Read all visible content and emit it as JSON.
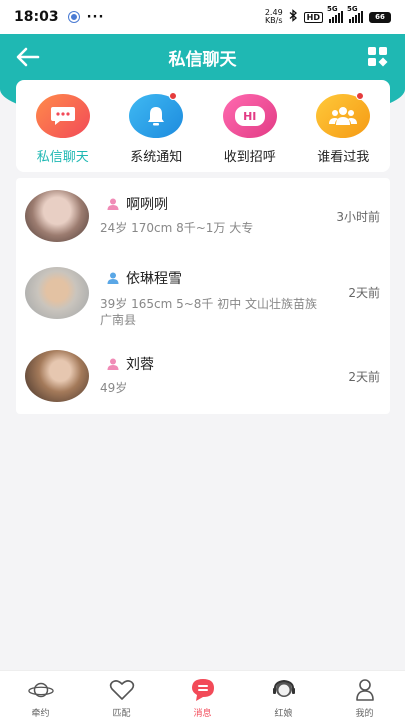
{
  "status_bar": {
    "time": "18:03",
    "net_speed_value": "2.49",
    "net_speed_unit": "KB/s",
    "hd": "HD",
    "sim1": "5G",
    "sim2": "5G",
    "battery": "66",
    "dots": "···"
  },
  "header": {
    "title": "私信聊天"
  },
  "categories": [
    {
      "label": "私信聊天",
      "icon": "chat-bubble-icon",
      "active": true,
      "badge": false
    },
    {
      "label": "系统通知",
      "icon": "bell-icon",
      "active": false,
      "badge": true
    },
    {
      "label": "收到招呼",
      "icon": "hi-icon",
      "active": false,
      "badge": false
    },
    {
      "label": "谁看过我",
      "icon": "group-icon",
      "active": false,
      "badge": true
    }
  ],
  "hi_text": "HI",
  "messages": [
    {
      "name": "啊咧咧",
      "detail": "24岁 170cm 8千~1万 大专",
      "time": "3小时前",
      "gender": "female"
    },
    {
      "name": "依琳程雪",
      "detail": "39岁 165cm 5~8千 初中 文山壮族苗族广南县",
      "time": "2天前",
      "gender": "male"
    },
    {
      "name": "刘蓉",
      "detail": "49岁",
      "time": "2天前",
      "gender": "female"
    }
  ],
  "tabs": [
    {
      "label": "牵约",
      "icon": "planet-icon",
      "active": false
    },
    {
      "label": "匹配",
      "icon": "heart-icon",
      "active": false
    },
    {
      "label": "消息",
      "icon": "message-icon",
      "active": true
    },
    {
      "label": "红娘",
      "icon": "matchmaker-icon",
      "active": false
    },
    {
      "label": "我的",
      "icon": "profile-icon",
      "active": false
    }
  ],
  "colors": {
    "accent": "#1fb8b3",
    "active_tab": "#f24a58",
    "badge": "#e53c3c"
  }
}
